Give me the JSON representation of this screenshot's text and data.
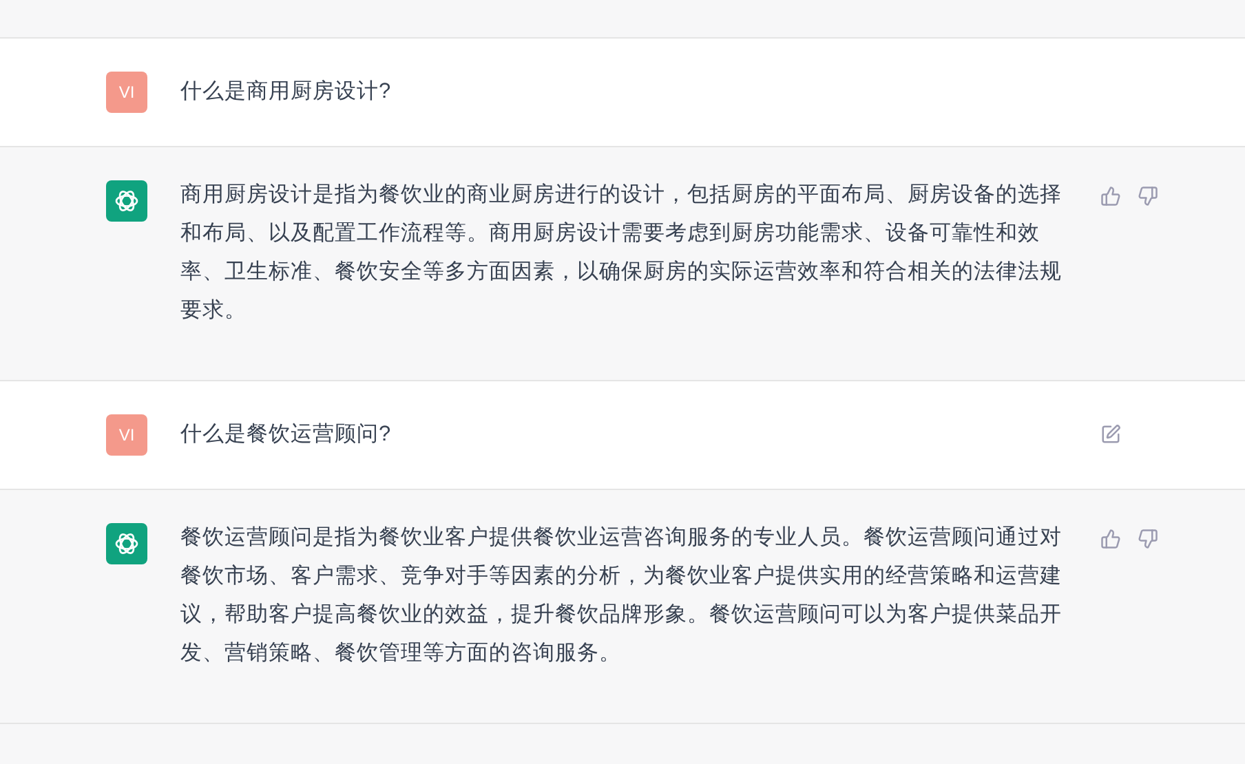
{
  "messages": [
    {
      "kind": "user",
      "avatar": "VI",
      "text": "什么是商用厨房设计?",
      "edit_icon": false
    },
    {
      "kind": "assistant",
      "text": "商用厨房设计是指为餐饮业的商业厨房进行的设计，包括厨房的平面布局、厨房设备的选择和布局、以及配置工作流程等。商用厨房设计需要考虑到厨房功能需求、设备可靠性和效率、卫生标准、餐饮安全等多方面因素，以确保厨房的实际运营效率和符合相关的法律法规要求。"
    },
    {
      "kind": "user",
      "avatar": "VI",
      "text": "什么是餐饮运营顾问?",
      "edit_icon": true
    },
    {
      "kind": "assistant",
      "text": "餐饮运营顾问是指为餐饮业客户提供餐饮业运营咨询服务的专业人员。餐饮运营顾问通过对餐饮市场、客户需求、竞争对手等因素的分析，为餐饮业客户提供实用的经营策略和运营建议，帮助客户提高餐饮业的效益，提升餐饮品牌形象。餐饮运营顾问可以为客户提供菜品开发、营销策略、餐饮管理等方面的咨询服务。"
    }
  ]
}
